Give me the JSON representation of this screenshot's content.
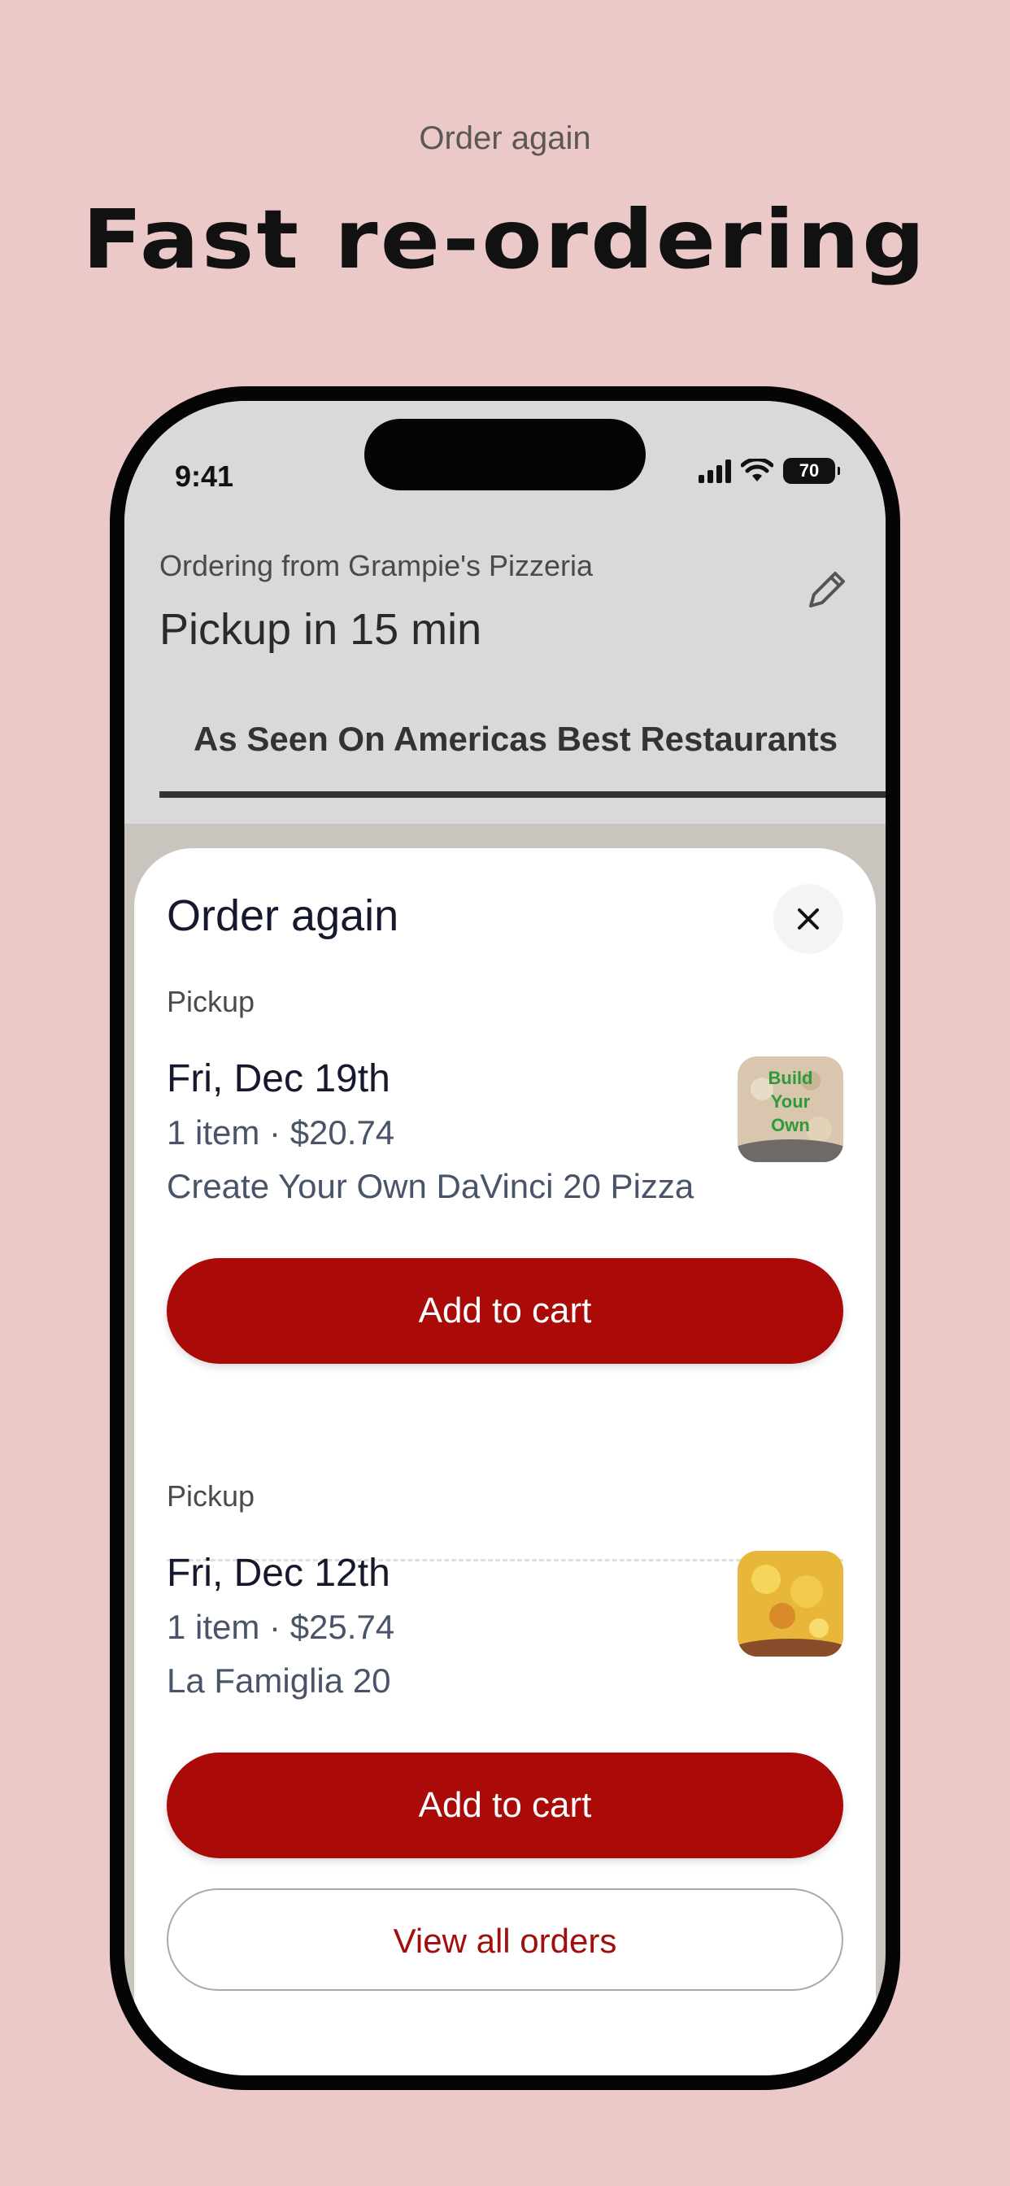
{
  "promo": {
    "eyebrow": "Order again",
    "headline": "Fast re-ordering"
  },
  "status_bar": {
    "time": "9:41",
    "battery": "70",
    "icons": [
      "signal-icon",
      "wifi-icon",
      "battery-icon"
    ]
  },
  "header": {
    "ordering_from": "Ordering from Grampie's Pizzeria",
    "pickup": "Pickup in 15 min",
    "edit_icon": "pencil-icon"
  },
  "menu_tab": {
    "label": "As Seen On Americas Best Restaurants"
  },
  "sheet": {
    "title": "Order again",
    "close_icon": "close-icon",
    "orders": [
      {
        "method": "Pickup",
        "date": "Fri, Dec 19th",
        "summary": "1 item · $20.74",
        "item_name": "Create Your Own DaVinci 20 Pizza",
        "thumb_text": [
          "Build",
          "Your",
          "Own"
        ],
        "button": "Add to cart"
      },
      {
        "method": "Pickup",
        "date": "Fri, Dec 12th",
        "summary": "1 item · $25.74",
        "item_name": "La Famiglia 20",
        "button": "Add to cart"
      }
    ],
    "view_all": "View all orders"
  },
  "colors": {
    "background": "#ecc9c9",
    "accent": "#aa0a08",
    "text_dark": "#16192e"
  }
}
